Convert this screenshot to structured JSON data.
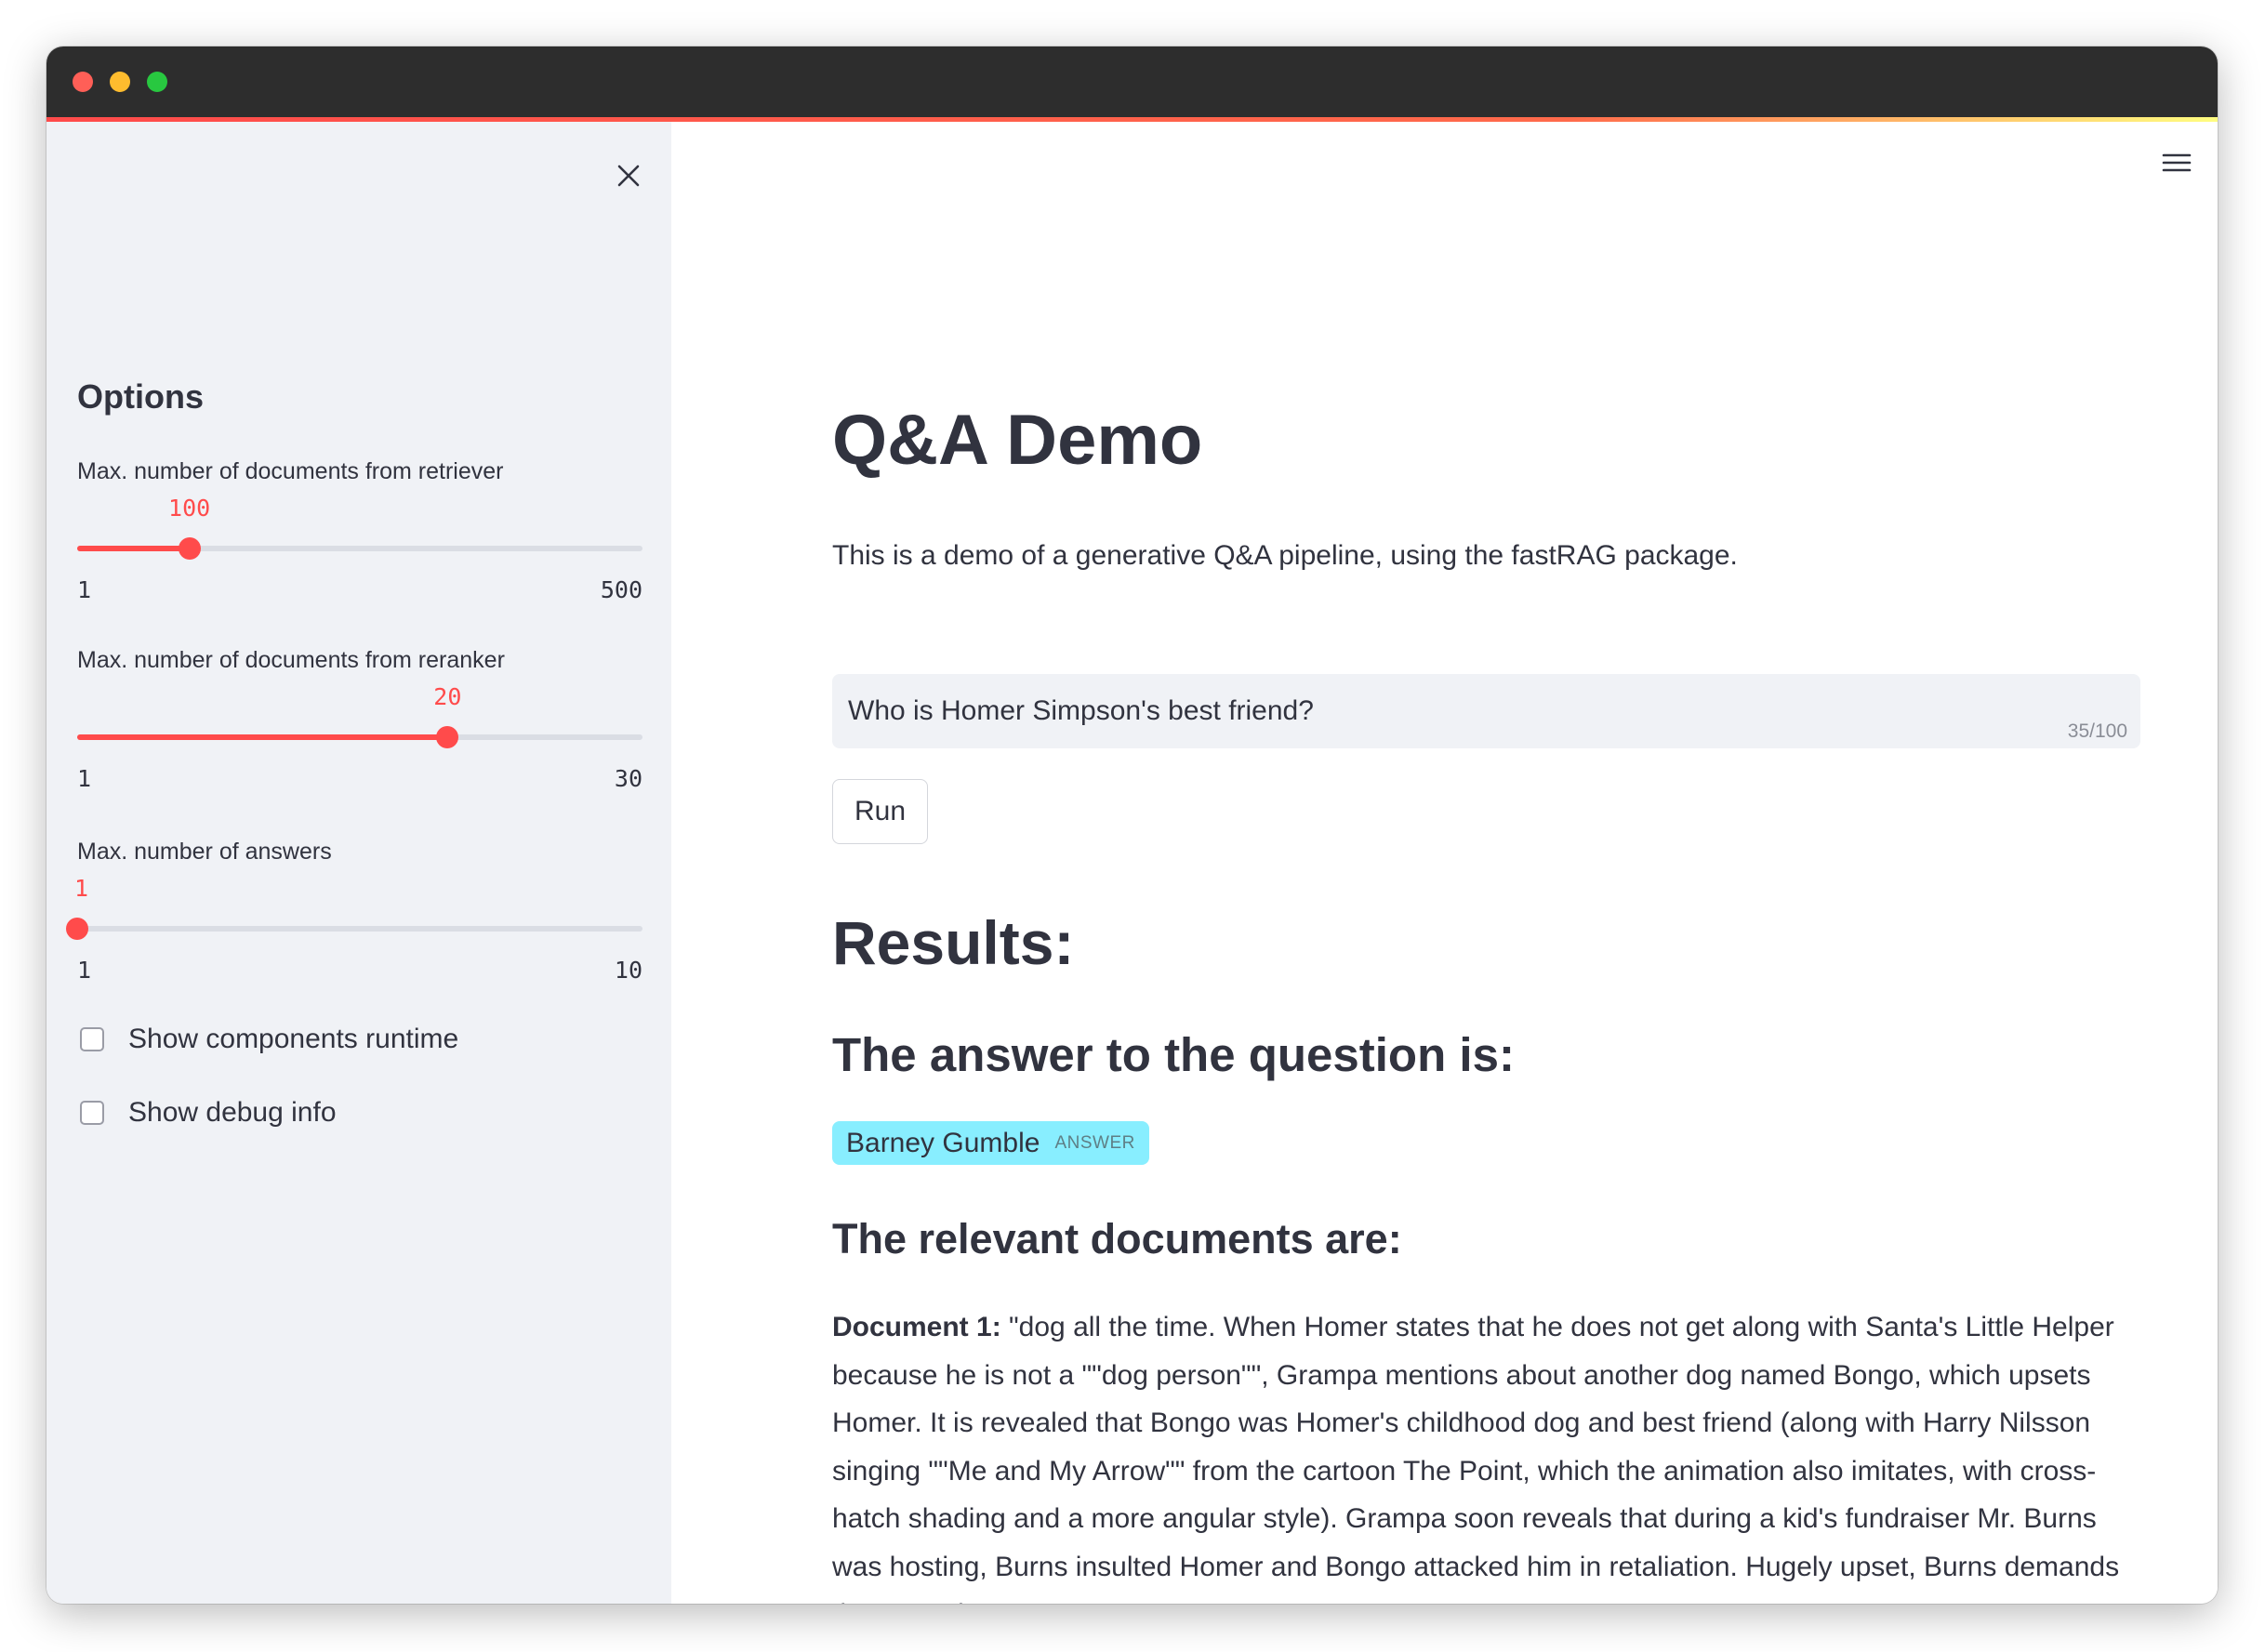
{
  "sidebar": {
    "heading": "Options",
    "sliders": [
      {
        "label": "Max. number of documents from retriever",
        "value": 100,
        "min": 1,
        "max": 500,
        "value_text": "100",
        "min_text": "1",
        "max_text": "500"
      },
      {
        "label": "Max. number of documents from reranker",
        "value": 20,
        "min": 1,
        "max": 30,
        "value_text": "20",
        "min_text": "1",
        "max_text": "30"
      },
      {
        "label": "Max. number of answers",
        "value": 1,
        "min": 1,
        "max": 10,
        "value_text": "1",
        "min_text": "1",
        "max_text": "10"
      }
    ],
    "checkboxes": [
      {
        "label": "Show components runtime",
        "checked": false
      },
      {
        "label": "Show debug info",
        "checked": false
      }
    ]
  },
  "main": {
    "title": "Q&A Demo",
    "intro": "This is a demo of a generative Q&A pipeline, using the fastRAG package.",
    "query": {
      "value": "Who is Homer Simpson's best friend?",
      "char_count": "35/100"
    },
    "run_label": "Run",
    "results_heading": "Results:",
    "answer_heading": "The answer to the question is:",
    "answer": {
      "text": "Barney Gumble",
      "tag": "ANSWER"
    },
    "documents_heading": "The relevant documents are:",
    "documents": [
      {
        "label": "Document 1:",
        "text": "\"dog all the time. When Homer states that he does not get along with Santa's Little Helper because he is not a \"\"dog person\"\", Grampa mentions about another dog named Bongo, which upsets Homer. It is revealed that Bongo was Homer's childhood dog and best friend (along with Harry Nilsson singing \"\"Me and My Arrow\"\" from the cartoon The Point, which the animation also imitates, with cross-hatch shading and a more angular style). Grampa soon reveals that during a kid's fundraiser Mr. Burns was hosting, Burns insulted Homer and Bongo attacked him in retaliation. Hugely upset, Burns demands that Grandpa\""
      }
    ]
  },
  "colors": {
    "accent": "#ff4b4b",
    "answer_chip": "#88eeff",
    "sidebar_bg": "#f0f2f6",
    "titlebar": "#2d2d2d"
  },
  "icons": {
    "close": "close-icon",
    "menu": "hamburger-menu-icon"
  }
}
